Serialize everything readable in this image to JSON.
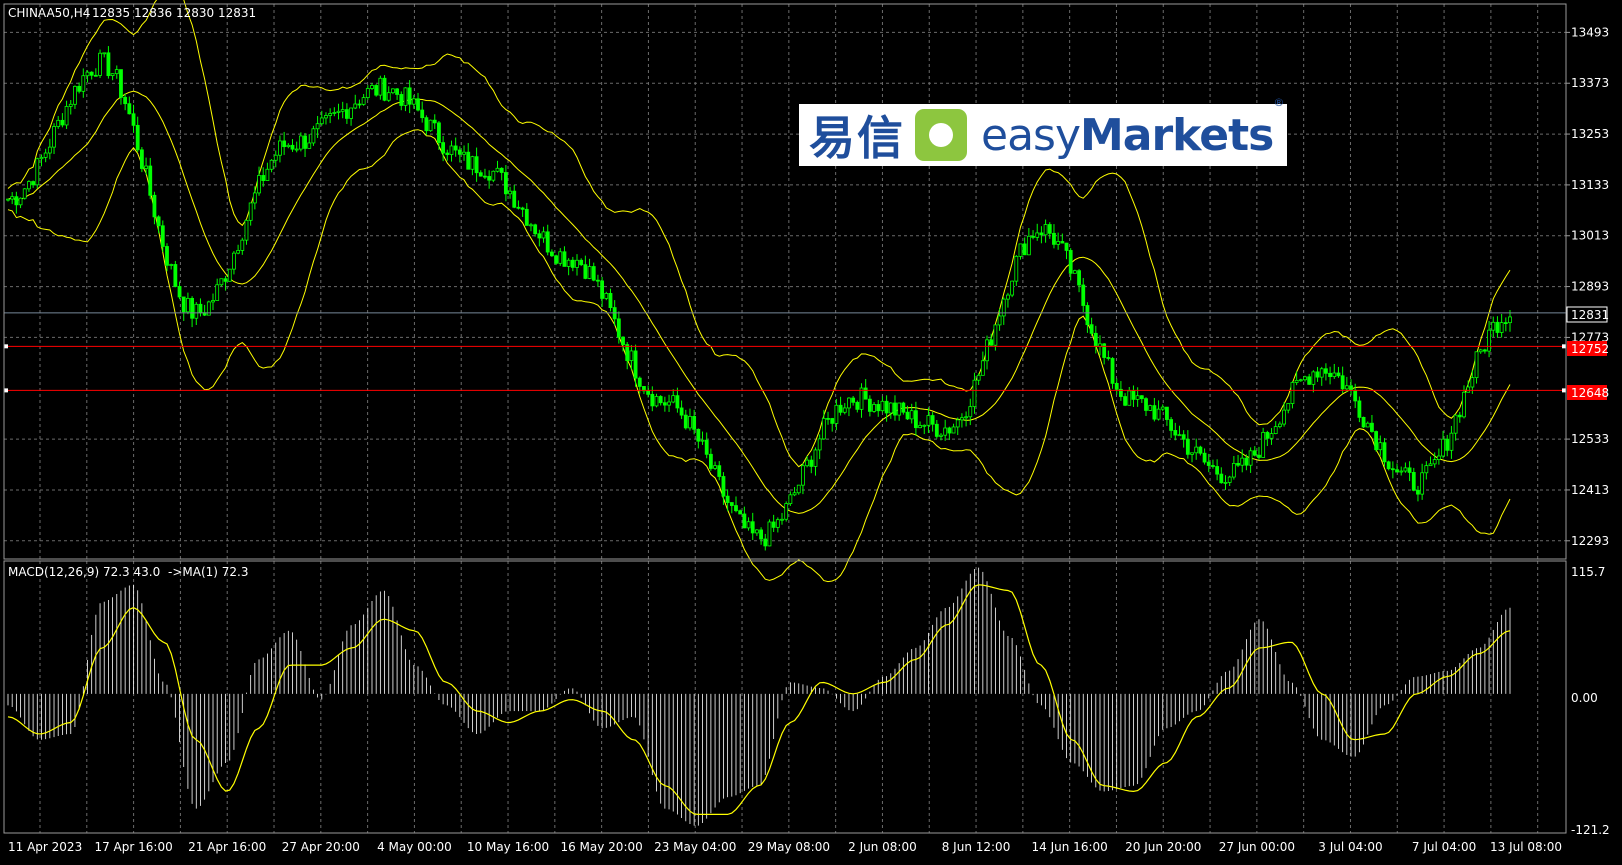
{
  "symbol": "CHINAA50,H4",
  "ohlc": "12835 12836 12830 12831",
  "indicator": {
    "label": "MACD(12,26,9) 72.3 43.0",
    "ma_label": "->MA(1) 72.3",
    "scale_top": "115.7",
    "scale_zero": "0.00",
    "scale_bottom": "-121.2"
  },
  "price_axis": [
    "13493",
    "13373",
    "13253",
    "13133",
    "13013",
    "12893",
    "12773",
    "12533",
    "12413",
    "12293"
  ],
  "markers": {
    "current": "12831",
    "level_1": "12752",
    "level_2": "12648"
  },
  "time_axis": [
    "11 Apr 2023",
    "17 Apr 16:00",
    "21 Apr 16:00",
    "27 Apr 20:00",
    "4 May 00:00",
    "10 May 16:00",
    "16 May 20:00",
    "23 May 04:00",
    "29 May 08:00",
    "2 Jun 08:00",
    "8 Jun 12:00",
    "14 Jun 16:00",
    "20 Jun 20:00",
    "27 Jun 00:00",
    "3 Jul 04:00",
    "7 Jul 04:00",
    "13 Jul 08:00"
  ],
  "logo": {
    "cn": "易信",
    "en_light": "easy",
    "en_bold": "Markets",
    "reg": "®"
  },
  "colors": {
    "background": "#000000",
    "candle": "#00ff00",
    "bands": "#ffff00",
    "grid": "#6b6b6b",
    "level_line": "#ff0000",
    "current_line": "#778899",
    "histogram": "#ffffff",
    "signal": "#ffff00"
  },
  "chart_data": [
    {
      "type": "line",
      "title": "CHINAA50,H4",
      "series": [
        {
          "name": "",
          "x": [
            "11 Apr 2023",
            "17 Apr 16:00",
            "21 Apr 16:00",
            "27 Apr 20:00",
            "4 May 00:00",
            "10 May 16:00",
            "16 May 20:00",
            "23 May 04:00",
            "29 May 08:00",
            "2 Jun 08:00",
            "8 Jun 12:00",
            "14 Jun 16:00",
            "20 Jun 20:00",
            "27 Jun 00:00",
            "3 Jul 04:00",
            "7 Jul 04:00",
            "13 Jul 08:00"
          ],
          "values": [
            13100,
            13420,
            12830,
            13230,
            13360,
            13180,
            12960,
            12620,
            12300,
            12630,
            12560,
            13030,
            12620,
            12450,
            12700,
            12430,
            12831
          ]
        }
      ],
      "ylim": [
        12250,
        13560
      ],
      "grid": true
    },
    {
      "type": "bar",
      "title": "MACD(12,26,9)",
      "values": [
        -10,
        -40,
        -35,
        80,
        95,
        10,
        -100,
        -60,
        30,
        55,
        -5,
        60,
        90,
        25,
        -10,
        -35,
        -15,
        -15,
        5,
        -30,
        -20,
        -100,
        -115,
        -90,
        -80,
        10,
        5,
        -15,
        15,
        40,
        75,
        110,
        50,
        -10,
        -60,
        -85,
        -80,
        -30,
        -15,
        20,
        65,
        10,
        -40,
        -55,
        -10,
        15,
        20,
        40,
        75
      ],
      "signal_values": [
        -20,
        -35,
        -25,
        40,
        75,
        45,
        -40,
        -85,
        -30,
        25,
        25,
        40,
        65,
        55,
        10,
        -15,
        -25,
        -15,
        -5,
        -15,
        -40,
        -80,
        -105,
        -105,
        -80,
        -25,
        10,
        0,
        10,
        30,
        60,
        95,
        90,
        25,
        -40,
        -80,
        -85,
        -60,
        -20,
        5,
        40,
        45,
        0,
        -40,
        -35,
        0,
        15,
        35,
        55
      ],
      "ylim": [
        -121.2,
        115.7
      ],
      "grid": true
    }
  ]
}
